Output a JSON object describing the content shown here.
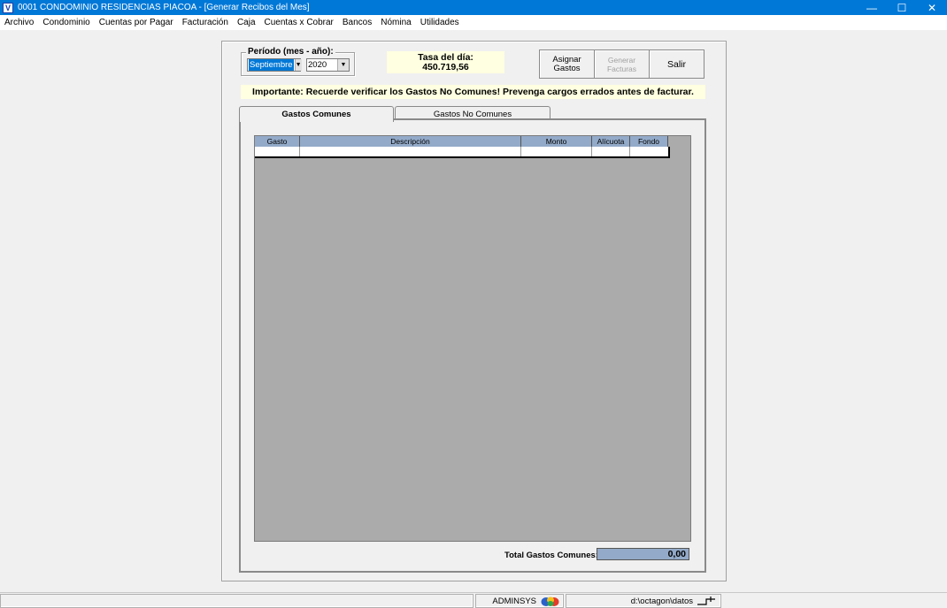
{
  "window": {
    "icon_letter": "V",
    "title": "0001  CONDOMINIO RESIDENCIAS PIACOA - [Generar Recibos del Mes]",
    "controls": {
      "minimize": "—",
      "maximize": "☐",
      "close": "✕"
    }
  },
  "menu": [
    "Archivo",
    "Condominio",
    "Cuentas por Pagar",
    "Facturación",
    "Caja",
    "Cuentas x Cobrar",
    "Bancos",
    "Nómina",
    "Utilidades"
  ],
  "period": {
    "legend": "Período (mes - año):",
    "month": "Septiembre",
    "year": "2020"
  },
  "rate": {
    "label": "Tasa del día:",
    "value": "450.719,56"
  },
  "buttons": {
    "assign": "Asignar Gastos",
    "generate_line1": "Generar",
    "generate_line2": "Facturas",
    "exit": "Salir"
  },
  "notice": "Importante: Recuerde verificar los Gastos No Comunes! Prevenga cargos errados antes de facturar.",
  "tabs": [
    {
      "label": "Gastos Comunes",
      "active": true
    },
    {
      "label": "Gastos No Comunes",
      "active": false
    }
  ],
  "grid": {
    "columns": [
      "Gasto",
      "Descripción",
      "Monto",
      "Alícuota",
      "Fondo"
    ]
  },
  "totals": {
    "label": "Total Gastos Comunes:",
    "value": "0,00"
  },
  "status": {
    "app": "ADMINSYS",
    "path": "d:\\octagon\\datos"
  },
  "colors": {
    "titlebar": "#0078d7",
    "highlight": "#ffffe1",
    "grid_header": "#93aac8",
    "grid_bg": "#ababab"
  }
}
